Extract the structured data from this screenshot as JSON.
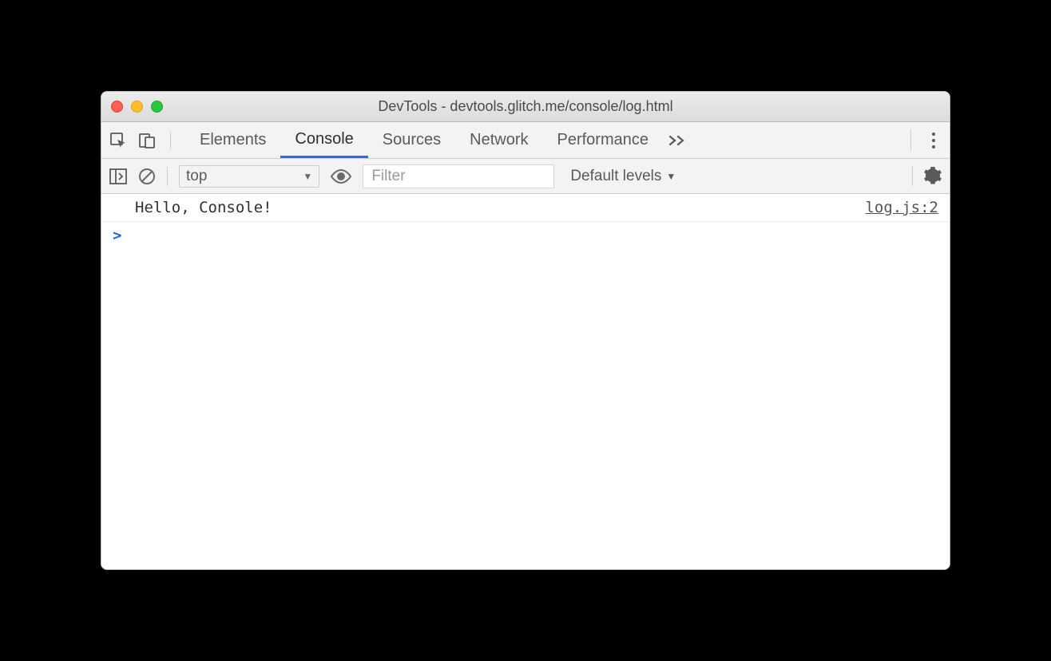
{
  "titlebar": {
    "title": "DevTools - devtools.glitch.me/console/log.html"
  },
  "tabs": {
    "elements": "Elements",
    "console": "Console",
    "sources": "Sources",
    "network": "Network",
    "performance": "Performance"
  },
  "toolbar": {
    "context": "top",
    "filter_placeholder": "Filter",
    "levels": "Default levels"
  },
  "console": {
    "message": "Hello, Console!",
    "source": "log.js:2",
    "prompt": ">"
  }
}
